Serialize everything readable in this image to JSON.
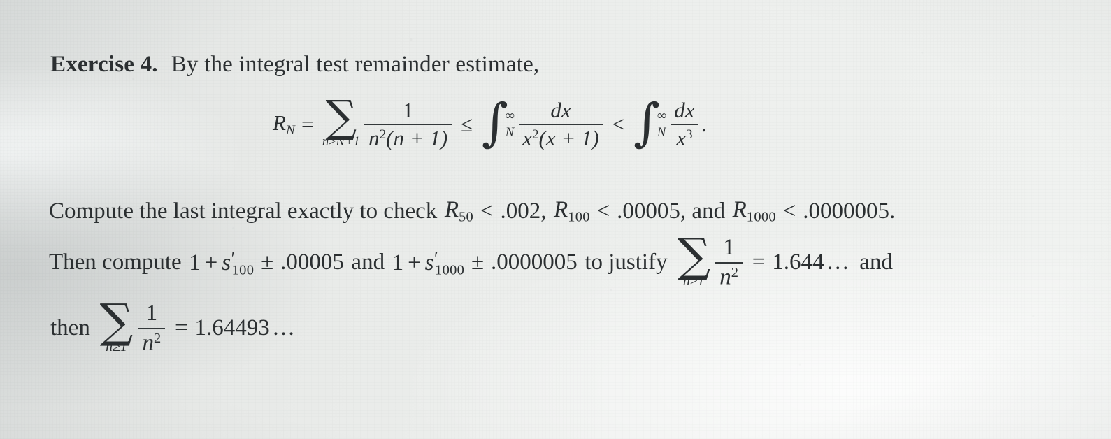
{
  "document": {
    "type": "textbook-exercise-photo",
    "background_color": "#e9ebe9",
    "ink_color": "#2b2f31"
  },
  "exercise": {
    "label": "Exercise 4.",
    "intro": "By the integral test remainder estimate,"
  },
  "display_equation": {
    "lhs_symbol": "R",
    "lhs_subscript": "N",
    "equals": "=",
    "sum": {
      "symbol": "∑",
      "limit": "n≥N+1",
      "numerator": "1",
      "denominator_base": "n",
      "denominator_exp": "2",
      "denominator_tail": "(n + 1)"
    },
    "rel1": "≤",
    "integral1": {
      "symbol": "∫",
      "lower": "N",
      "upper": "∞",
      "numerator": "dx",
      "denominator_base": "x",
      "denominator_exp": "2",
      "denominator_tail": "(x + 1)"
    },
    "rel2": "<",
    "integral2": {
      "symbol": "∫",
      "lower": "N",
      "upper": "∞",
      "numerator": "dx",
      "denominator_base": "x",
      "denominator_exp": "3"
    },
    "terminator": "."
  },
  "paragraph": {
    "line2": {
      "lead": "Compute the last integral exactly to check",
      "bound1": {
        "symbol": "R",
        "subscript": "50",
        "relation": "<",
        "value": ".002"
      },
      "comma": ",",
      "bound2": {
        "symbol": "R",
        "subscript": "100",
        "relation": "<",
        "value": ".00005"
      },
      "conjunction": ", and",
      "bound3": {
        "symbol": "R",
        "subscript": "1000",
        "relation": "<",
        "value": ".0000005"
      },
      "period": "."
    },
    "line3": {
      "lead": "Then compute",
      "term1": {
        "one": "1",
        "plus": "+",
        "symbol": "s",
        "prime": "′",
        "subscript": "100",
        "pm": "±",
        "value": ".00005"
      },
      "and": "and",
      "term2": {
        "one": "1",
        "plus": "+",
        "symbol": "s",
        "prime": "′",
        "subscript": "1000",
        "pm": "±",
        "value": ".0000005"
      },
      "purpose": "to justify",
      "sum": {
        "symbol": "∑",
        "limit": "n≥1",
        "numerator": "1",
        "denominator_base": "n",
        "denominator_exp": "2"
      },
      "equals": "=",
      "value": "1.644",
      "ellipsis": "…",
      "trailing": "and"
    },
    "line4": {
      "lead": "then",
      "sum": {
        "symbol": "∑",
        "limit": "n≥1",
        "numerator": "1",
        "denominator_base": "n",
        "denominator_exp": "2"
      },
      "equals": "=",
      "value": "1.64493",
      "ellipsis": "…"
    }
  }
}
